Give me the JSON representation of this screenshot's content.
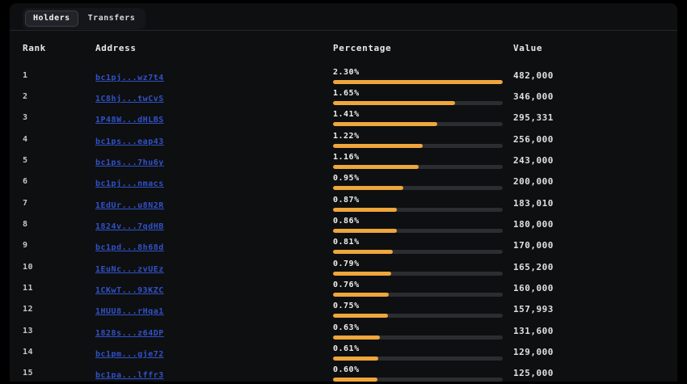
{
  "tabs": [
    {
      "label": "Holders",
      "active": true
    },
    {
      "label": "Transfers",
      "active": false
    }
  ],
  "table": {
    "headers": [
      "Rank",
      "Address",
      "Percentage",
      "Value"
    ],
    "max_percentage": 2.3,
    "rows": [
      {
        "rank": "1",
        "address": "bc1pj...wz7t4",
        "percentage": 2.3,
        "percentage_label": "2.30%",
        "value": "482,000"
      },
      {
        "rank": "2",
        "address": "1C8hj...twCvS",
        "percentage": 1.65,
        "percentage_label": "1.65%",
        "value": "346,000"
      },
      {
        "rank": "3",
        "address": "1P48W...dHLBS",
        "percentage": 1.41,
        "percentage_label": "1.41%",
        "value": "295,331"
      },
      {
        "rank": "4",
        "address": "bc1ps...eap43",
        "percentage": 1.22,
        "percentage_label": "1.22%",
        "value": "256,000"
      },
      {
        "rank": "5",
        "address": "bc1ps...7hu6y",
        "percentage": 1.16,
        "percentage_label": "1.16%",
        "value": "243,000"
      },
      {
        "rank": "6",
        "address": "bc1pj...nmacs",
        "percentage": 0.95,
        "percentage_label": "0.95%",
        "value": "200,000"
      },
      {
        "rank": "7",
        "address": "1EdUr...u8N2R",
        "percentage": 0.87,
        "percentage_label": "0.87%",
        "value": "183,010"
      },
      {
        "rank": "8",
        "address": "1824v...7qdHB",
        "percentage": 0.86,
        "percentage_label": "0.86%",
        "value": "180,000"
      },
      {
        "rank": "9",
        "address": "bc1pd...8h68d",
        "percentage": 0.81,
        "percentage_label": "0.81%",
        "value": "170,000"
      },
      {
        "rank": "10",
        "address": "1EuNc...zvUEz",
        "percentage": 0.79,
        "percentage_label": "0.79%",
        "value": "165,200"
      },
      {
        "rank": "11",
        "address": "1CKwT...93KZC",
        "percentage": 0.76,
        "percentage_label": "0.76%",
        "value": "160,000"
      },
      {
        "rank": "12",
        "address": "1HUU8...rHqa1",
        "percentage": 0.75,
        "percentage_label": "0.75%",
        "value": "157,993"
      },
      {
        "rank": "13",
        "address": "1828s...z64DP",
        "percentage": 0.63,
        "percentage_label": "0.63%",
        "value": "131,600"
      },
      {
        "rank": "14",
        "address": "bc1pm...gje72",
        "percentage": 0.61,
        "percentage_label": "0.61%",
        "value": "129,000"
      },
      {
        "rank": "15",
        "address": "bc1pa...lffr3",
        "percentage": 0.6,
        "percentage_label": "0.60%",
        "value": "125,000"
      }
    ]
  },
  "colors": {
    "page_background": "#000000",
    "card_background": "#0e0f11",
    "bar_fill": "#efa63b",
    "bar_track": "#2b2d30",
    "link": "#3152c8",
    "separator": "#25272b",
    "active_tab_background": "#212329"
  }
}
